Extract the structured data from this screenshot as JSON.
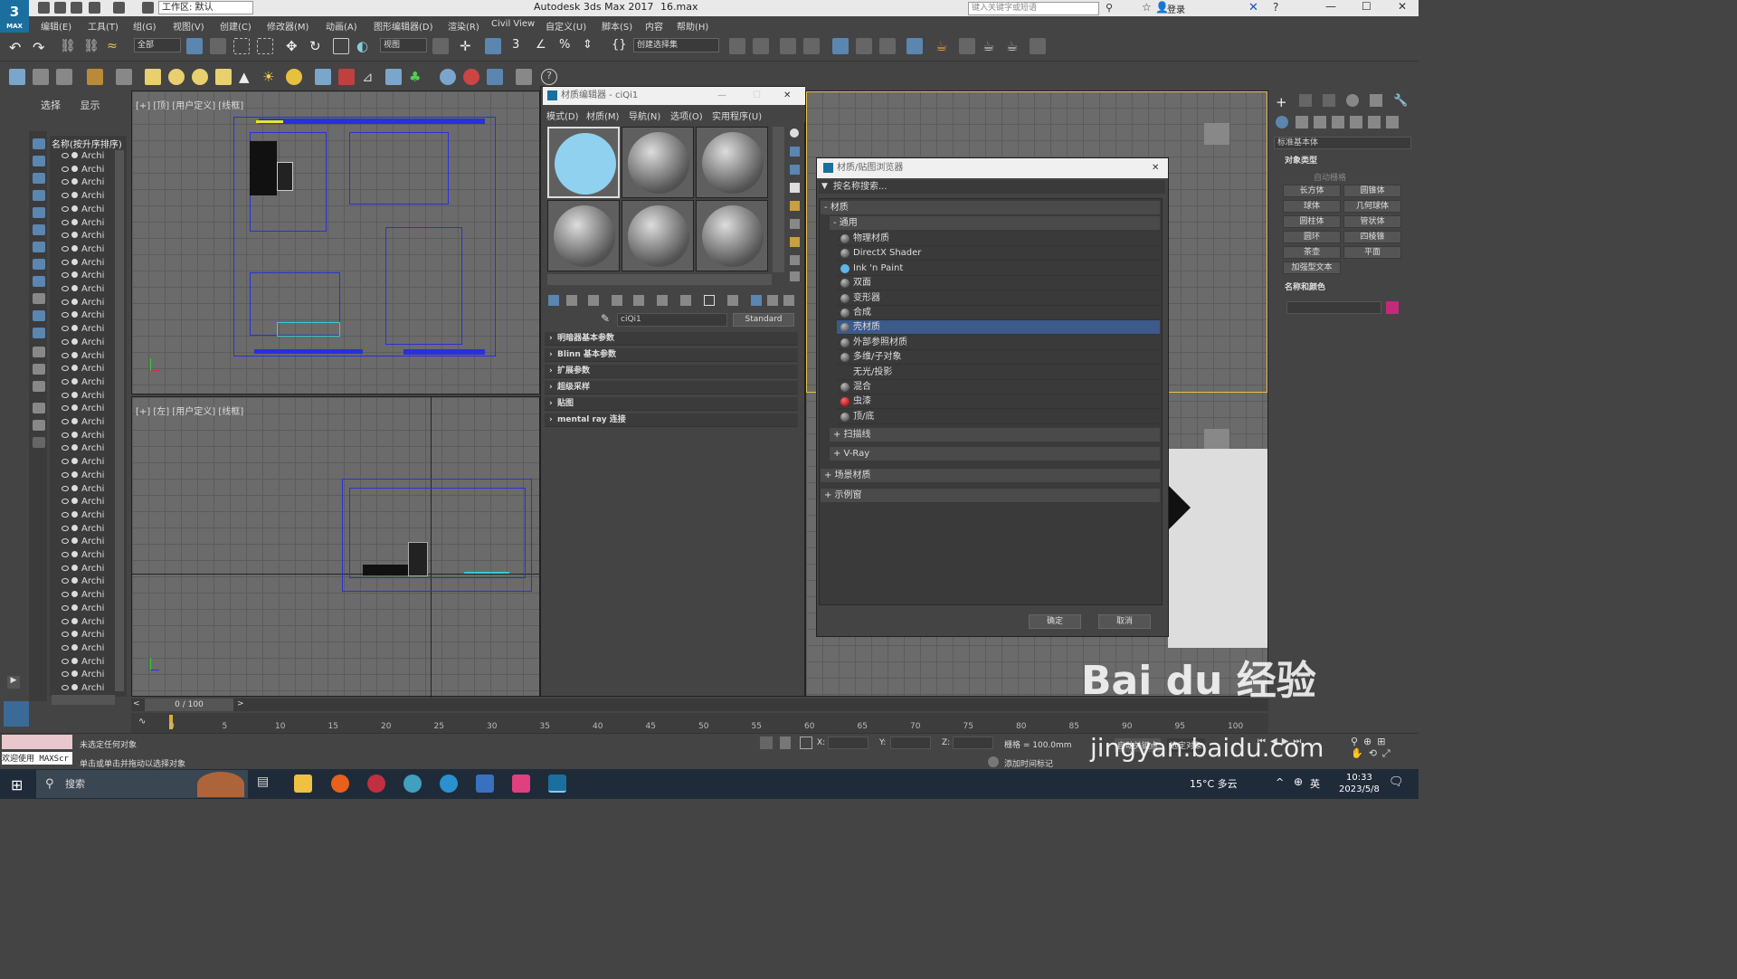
{
  "titlebar": {
    "logo": "3",
    "logo_sub": "MAX",
    "workspace": "工作区: 默认",
    "app_title": "Autodesk 3ds Max 2017",
    "file_name": "16.max",
    "search_placeholder": "键入关键字或短语",
    "login": "登录"
  },
  "menus": [
    "编辑(E)",
    "工具(T)",
    "组(G)",
    "视图(V)",
    "创建(C)",
    "修改器(M)",
    "动画(A)",
    "图形编辑器(D)",
    "渲染(R)",
    "Civil View",
    "自定义(U)",
    "脚本(S)",
    "内容",
    "帮助(H)"
  ],
  "toolbar": {
    "filter": "全部",
    "ref_coord": "视图",
    "selection_set": "创建选择集"
  },
  "explorer": {
    "tabs": [
      "选择",
      "显示"
    ],
    "header": "名称(按升序排序)",
    "row_label": "Archi"
  },
  "viewports": {
    "top_label": "[+] [顶] [用户定义] [线框]",
    "left_label": "[+] [左] [用户定义] [线框]"
  },
  "material_editor": {
    "title": "材质编辑器 - ciQi1",
    "menus": [
      "模式(D)",
      "材质(M)",
      "导航(N)",
      "选项(O)",
      "实用程序(U)"
    ],
    "slot_name": "ciQi1",
    "type": "Standard",
    "rollouts": [
      "明暗器基本参数",
      "Blinn 基本参数",
      "扩展参数",
      "超级采样",
      "贴图",
      "mental ray 连接"
    ]
  },
  "browser": {
    "title": "材质/贴图浏览器",
    "search": "按名称搜索...",
    "group_materials": "- 材质",
    "group_general": "- 通用",
    "items": [
      {
        "label": "物理材质",
        "ball": "gray"
      },
      {
        "label": "DirectX Shader",
        "ball": "gray"
      },
      {
        "label": "Ink 'n Paint",
        "ball": "blue"
      },
      {
        "label": "双面",
        "ball": "gray"
      },
      {
        "label": "变形器",
        "ball": "gray"
      },
      {
        "label": "合成",
        "ball": "gray"
      },
      {
        "label": "壳材质",
        "ball": "gray"
      },
      {
        "label": "外部参照材质",
        "ball": "gray"
      },
      {
        "label": "多维/子对象",
        "ball": "gray"
      },
      {
        "label": "无光/投影",
        "ball": "none"
      },
      {
        "label": "混合",
        "ball": "gray"
      },
      {
        "label": "虫漆",
        "ball": "red"
      },
      {
        "label": "顶/底",
        "ball": "gray"
      }
    ],
    "selected_index": 6,
    "sub_scanline": "+ 扫描线",
    "sub_vray": "+ V-Ray",
    "scene_materials": "+ 场景材质",
    "sample_slots": "+ 示例窗",
    "ok": "确定",
    "cancel": "取消"
  },
  "command_panel": {
    "dropdown": "标准基本体",
    "section_object_type": "对象类型",
    "auto_grid": "自动栅格",
    "buttons": [
      "长方体",
      "圆锥体",
      "球体",
      "几何球体",
      "圆柱体",
      "管状体",
      "圆环",
      "四棱锥",
      "茶壶",
      "平面",
      "加强型文本"
    ],
    "section_name_color": "名称和颜色",
    "swatch_color": "#c42a7a"
  },
  "timeline": {
    "frame": "0 / 100",
    "ticks": [
      "0",
      "5",
      "10",
      "15",
      "20",
      "25",
      "30",
      "35",
      "40",
      "45",
      "50",
      "55",
      "60",
      "65",
      "70",
      "75",
      "80",
      "85",
      "90",
      "95",
      "100"
    ]
  },
  "status": {
    "welcome": "欢迎使用 MAXScr",
    "line1": "未选定任何对象",
    "line2": "单击或单击并拖动以选择对象",
    "x_label": "X:",
    "y_label": "Y:",
    "z_label": "Z:",
    "grid": "栅格 = 100.0mm",
    "add_time_tag": "添加时间标记",
    "auto_key": "自动关键点",
    "set_key": "选定对象"
  },
  "taskbar": {
    "search": "搜索",
    "weather": "15°C 多云",
    "ime": "英",
    "time": "10:33",
    "date": "2023/5/8"
  },
  "watermark": {
    "line1": "Bai du 经验",
    "line2": "jingyan.baidu.com"
  }
}
